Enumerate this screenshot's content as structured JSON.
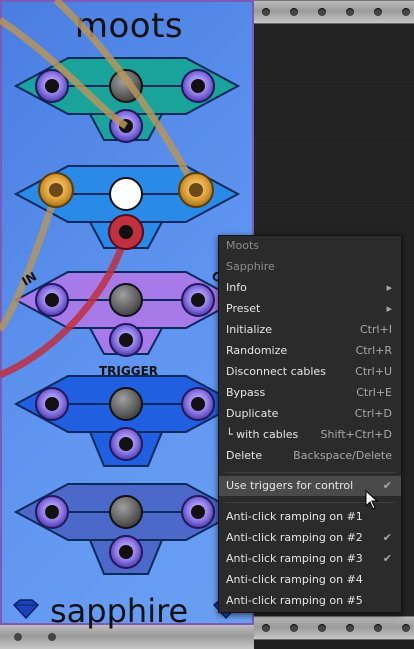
{
  "module": {
    "title": "moots",
    "brand": "sapphire",
    "labels": {
      "in": "IN",
      "out": "O",
      "trigger": "TRIGGER"
    }
  },
  "menu": {
    "header1": "Moots",
    "header2": "Sapphire",
    "items": [
      {
        "label": "Info",
        "shortcut": "▸"
      },
      {
        "label": "Preset",
        "shortcut": "▸"
      },
      {
        "label": "Initialize",
        "shortcut": "Ctrl+I"
      },
      {
        "label": "Randomize",
        "shortcut": "Ctrl+R"
      },
      {
        "label": "Disconnect cables",
        "shortcut": "Ctrl+U"
      },
      {
        "label": "Bypass",
        "shortcut": "Ctrl+E"
      },
      {
        "label": "Duplicate",
        "shortcut": "Ctrl+D"
      },
      {
        "label": "└ with cables",
        "shortcut": "Shift+Ctrl+D"
      },
      {
        "label": "Delete",
        "shortcut": "Backspace/Delete"
      }
    ],
    "use_triggers": {
      "label": "Use triggers for control",
      "check": "✔"
    },
    "antiClick": [
      {
        "label": "Anti-click ramping on #1",
        "check": ""
      },
      {
        "label": "Anti-click ramping on #2",
        "check": "✔"
      },
      {
        "label": "Anti-click ramping on #3",
        "check": "✔"
      },
      {
        "label": "Anti-click ramping on #4",
        "check": ""
      },
      {
        "label": "Anti-click ramping on #5",
        "check": ""
      }
    ]
  },
  "colors": {
    "panel_blue": "#5a8ff0",
    "teal": "#1aa3a3",
    "violet": "#a777e6",
    "menu_bg": "#2b2b2b",
    "menu_highlight": "#4a4a4a",
    "cable_tan": "#b7955a",
    "cable_red": "#c0303f"
  }
}
